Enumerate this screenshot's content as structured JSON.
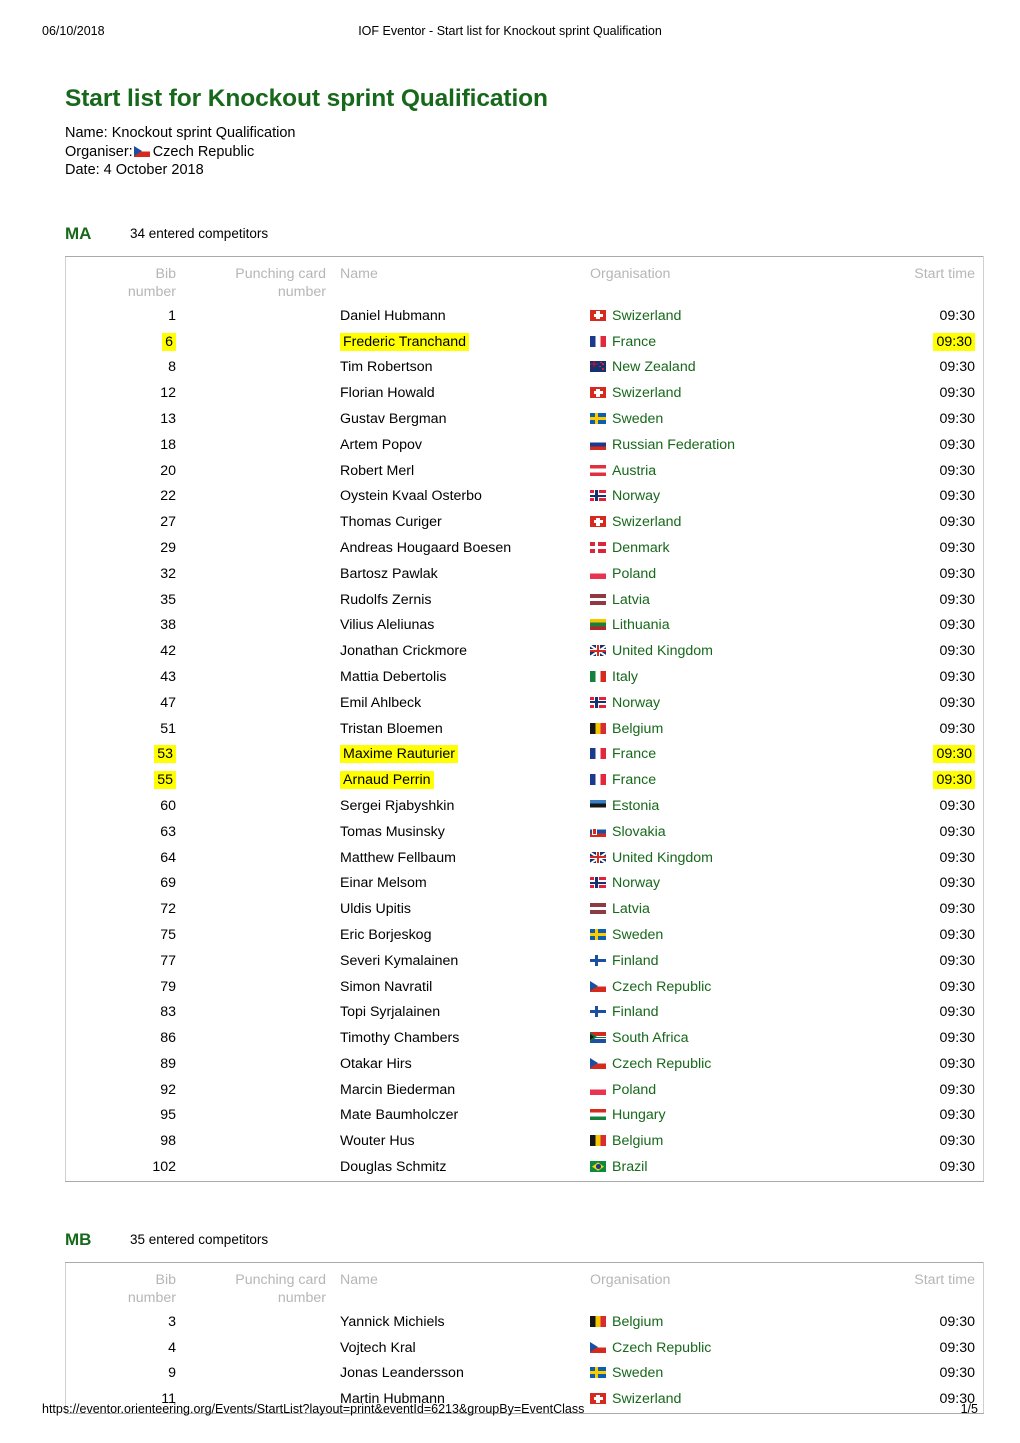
{
  "print_header": {
    "date": "06/10/2018",
    "title": "IOF Eventor - Start list for Knockout sprint Qualification"
  },
  "print_footer": {
    "url": "https://eventor.orienteering.org/Events/StartList?layout=print&eventId=6213&groupBy=EventClass",
    "page": "1/5"
  },
  "document": {
    "title": "Start list for Knockout sprint Qualification",
    "meta": {
      "name_label": "Name: Knockout sprint Qualification",
      "organiser_label": "Organiser:",
      "organiser_value": "Czech Republic",
      "organiser_flag": "cz",
      "date_label": "Date: 4 October 2018"
    }
  },
  "table_headers": {
    "bib": "Bib number",
    "bib_line1": "Bib",
    "bib_line2": "number",
    "card_line1": "Punching card",
    "card_line2": "number",
    "name": "Name",
    "organisation": "Organisation",
    "start_time": "Start time"
  },
  "colors": {
    "heading_green": "#17681b",
    "org_link_green": "#17681b",
    "header_gray": "#b6b6b6",
    "highlight_yellow": "#ffff00",
    "table_border": "#aaaaaa"
  },
  "classes": [
    {
      "name": "MA",
      "count": "34 entered competitors",
      "rows": [
        {
          "bib": "1",
          "card": "",
          "name": "Daniel Hubmann",
          "org": "Swizerland",
          "flag": "ch",
          "time": "09:30",
          "highlight": false
        },
        {
          "bib": "6",
          "card": "",
          "name": "Frederic Tranchand",
          "org": "France",
          "flag": "fr",
          "time": "09:30",
          "highlight": true
        },
        {
          "bib": "8",
          "card": "",
          "name": "Tim Robertson",
          "org": "New Zealand",
          "flag": "nz",
          "time": "09:30",
          "highlight": false
        },
        {
          "bib": "12",
          "card": "",
          "name": "Florian Howald",
          "org": "Swizerland",
          "flag": "ch",
          "time": "09:30",
          "highlight": false
        },
        {
          "bib": "13",
          "card": "",
          "name": "Gustav Bergman",
          "org": "Sweden",
          "flag": "se",
          "time": "09:30",
          "highlight": false
        },
        {
          "bib": "18",
          "card": "",
          "name": "Artem Popov",
          "org": "Russian Federation",
          "flag": "ru",
          "time": "09:30",
          "highlight": false
        },
        {
          "bib": "20",
          "card": "",
          "name": "Robert Merl",
          "org": "Austria",
          "flag": "at",
          "time": "09:30",
          "highlight": false
        },
        {
          "bib": "22",
          "card": "",
          "name": "Oystein Kvaal Osterbo",
          "org": "Norway",
          "flag": "no",
          "time": "09:30",
          "highlight": false
        },
        {
          "bib": "27",
          "card": "",
          "name": "Thomas Curiger",
          "org": "Swizerland",
          "flag": "ch",
          "time": "09:30",
          "highlight": false
        },
        {
          "bib": "29",
          "card": "",
          "name": "Andreas Hougaard Boesen",
          "org": "Denmark",
          "flag": "dk",
          "time": "09:30",
          "highlight": false
        },
        {
          "bib": "32",
          "card": "",
          "name": "Bartosz Pawlak",
          "org": "Poland",
          "flag": "pl",
          "time": "09:30",
          "highlight": false
        },
        {
          "bib": "35",
          "card": "",
          "name": "Rudolfs Zernis",
          "org": "Latvia",
          "flag": "lv",
          "time": "09:30",
          "highlight": false
        },
        {
          "bib": "38",
          "card": "",
          "name": "Vilius Aleliunas",
          "org": "Lithuania",
          "flag": "lt",
          "time": "09:30",
          "highlight": false
        },
        {
          "bib": "42",
          "card": "",
          "name": "Jonathan Crickmore",
          "org": "United Kingdom",
          "flag": "gb",
          "time": "09:30",
          "highlight": false
        },
        {
          "bib": "43",
          "card": "",
          "name": "Mattia Debertolis",
          "org": "Italy",
          "flag": "it",
          "time": "09:30",
          "highlight": false
        },
        {
          "bib": "47",
          "card": "",
          "name": "Emil Ahlbeck",
          "org": "Norway",
          "flag": "no",
          "time": "09:30",
          "highlight": false
        },
        {
          "bib": "51",
          "card": "",
          "name": "Tristan Bloemen",
          "org": "Belgium",
          "flag": "be",
          "time": "09:30",
          "highlight": false
        },
        {
          "bib": "53",
          "card": "",
          "name": "Maxime Rauturier",
          "org": "France",
          "flag": "fr",
          "time": "09:30",
          "highlight": true
        },
        {
          "bib": "55",
          "card": "",
          "name": "Arnaud Perrin",
          "org": "France",
          "flag": "fr",
          "time": "09:30",
          "highlight": true
        },
        {
          "bib": "60",
          "card": "",
          "name": "Sergei Rjabyshkin",
          "org": "Estonia",
          "flag": "ee",
          "time": "09:30",
          "highlight": false
        },
        {
          "bib": "63",
          "card": "",
          "name": "Tomas Musinsky",
          "org": "Slovakia",
          "flag": "sk",
          "time": "09:30",
          "highlight": false
        },
        {
          "bib": "64",
          "card": "",
          "name": "Matthew Fellbaum",
          "org": "United Kingdom",
          "flag": "gb",
          "time": "09:30",
          "highlight": false
        },
        {
          "bib": "69",
          "card": "",
          "name": "Einar Melsom",
          "org": "Norway",
          "flag": "no",
          "time": "09:30",
          "highlight": false
        },
        {
          "bib": "72",
          "card": "",
          "name": "Uldis Upitis",
          "org": "Latvia",
          "flag": "lv",
          "time": "09:30",
          "highlight": false
        },
        {
          "bib": "75",
          "card": "",
          "name": "Eric Borjeskog",
          "org": "Sweden",
          "flag": "se",
          "time": "09:30",
          "highlight": false
        },
        {
          "bib": "77",
          "card": "",
          "name": "Severi Kymalainen",
          "org": "Finland",
          "flag": "fi",
          "time": "09:30",
          "highlight": false
        },
        {
          "bib": "79",
          "card": "",
          "name": "Simon Navratil",
          "org": "Czech Republic",
          "flag": "cz",
          "time": "09:30",
          "highlight": false
        },
        {
          "bib": "83",
          "card": "",
          "name": "Topi Syrjalainen",
          "org": "Finland",
          "flag": "fi",
          "time": "09:30",
          "highlight": false
        },
        {
          "bib": "86",
          "card": "",
          "name": "Timothy Chambers",
          "org": "South Africa",
          "flag": "za",
          "time": "09:30",
          "highlight": false
        },
        {
          "bib": "89",
          "card": "",
          "name": "Otakar Hirs",
          "org": "Czech Republic",
          "flag": "cz",
          "time": "09:30",
          "highlight": false
        },
        {
          "bib": "92",
          "card": "",
          "name": "Marcin Biederman",
          "org": "Poland",
          "flag": "pl",
          "time": "09:30",
          "highlight": false
        },
        {
          "bib": "95",
          "card": "",
          "name": "Mate Baumholczer",
          "org": "Hungary",
          "flag": "hu",
          "time": "09:30",
          "highlight": false
        },
        {
          "bib": "98",
          "card": "",
          "name": "Wouter Hus",
          "org": "Belgium",
          "flag": "be",
          "time": "09:30",
          "highlight": false
        },
        {
          "bib": "102",
          "card": "",
          "name": "Douglas Schmitz",
          "org": "Brazil",
          "flag": "br",
          "time": "09:30",
          "highlight": false
        }
      ]
    },
    {
      "name": "MB",
      "count": "35 entered competitors",
      "rows": [
        {
          "bib": "3",
          "card": "",
          "name": "Yannick Michiels",
          "org": "Belgium",
          "flag": "be",
          "time": "09:30",
          "highlight": false
        },
        {
          "bib": "4",
          "card": "",
          "name": "Vojtech Kral",
          "org": "Czech Republic",
          "flag": "cz",
          "time": "09:30",
          "highlight": false
        },
        {
          "bib": "9",
          "card": "",
          "name": "Jonas Leandersson",
          "org": "Sweden",
          "flag": "se",
          "time": "09:30",
          "highlight": false
        },
        {
          "bib": "11",
          "card": "",
          "name": "Martin Hubmann",
          "org": "Swizerland",
          "flag": "ch",
          "time": "09:30",
          "highlight": false
        }
      ]
    }
  ]
}
